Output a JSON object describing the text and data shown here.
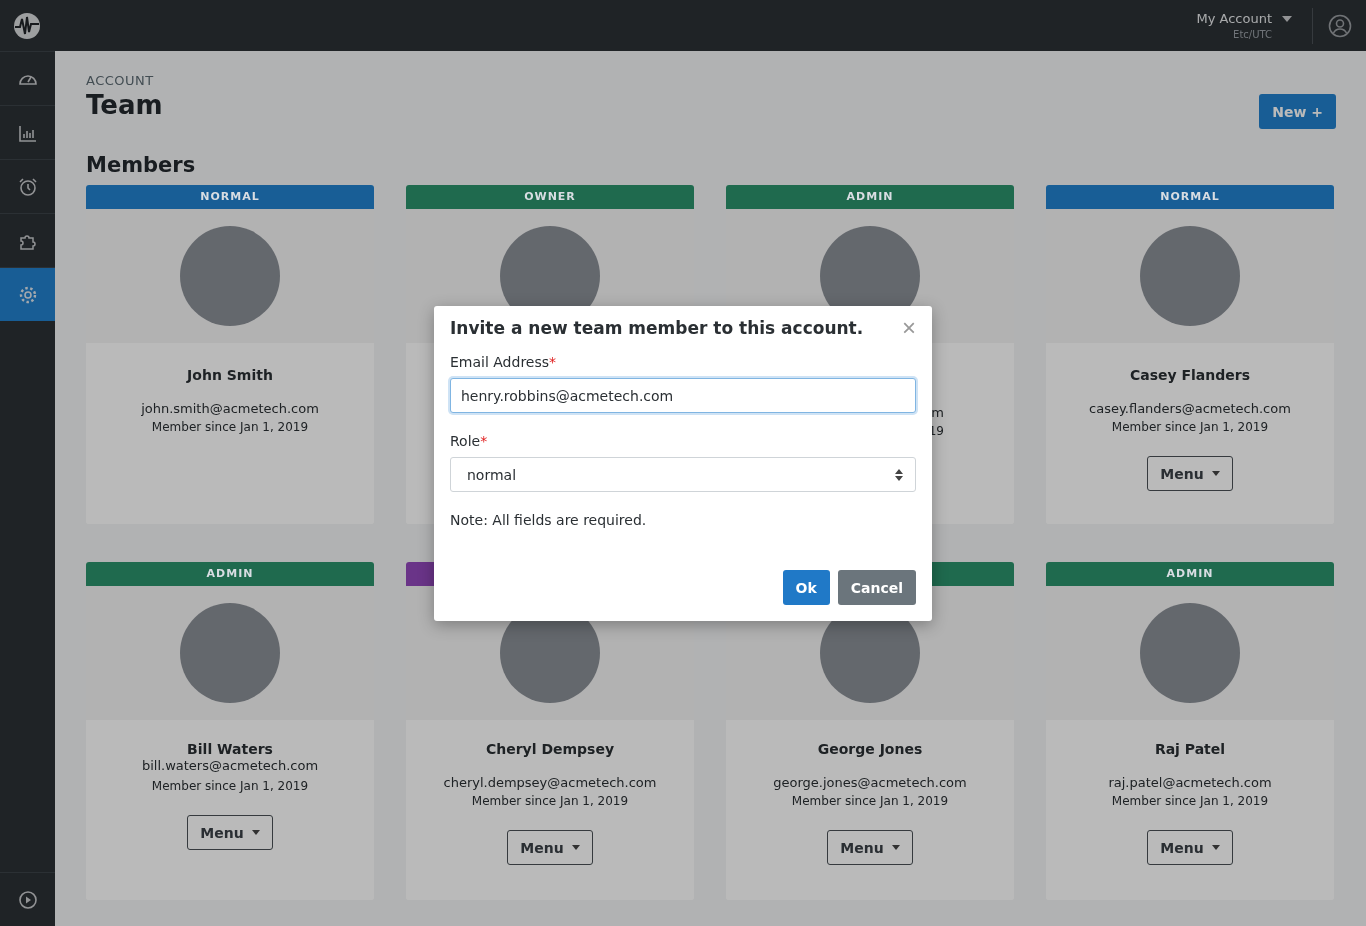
{
  "topbar": {
    "account": "My Account",
    "timezone": "Etc/UTC"
  },
  "sidebar": {
    "items": [
      {
        "kind": "gauge",
        "selected": false
      },
      {
        "kind": "chart",
        "selected": false
      },
      {
        "kind": "alarm",
        "selected": false
      },
      {
        "kind": "puzzle",
        "selected": false
      },
      {
        "kind": "gear",
        "selected": true
      }
    ],
    "bottom": {
      "kind": "play"
    }
  },
  "header": {
    "eyebrow": "ACCOUNT",
    "title": "Team",
    "new_button": "New +"
  },
  "section_title": "Members",
  "members": [
    {
      "role": "NORMAL",
      "color": "#185e96",
      "name": "John Smith",
      "email": "john.smith@acmetech.com",
      "since": "Member since Jan 1, 2019"
    },
    {
      "role": "OWNER",
      "color": "#1f6a4e"
    },
    {
      "role": "ADMIN",
      "color": "#1f6a4e",
      "email": "m",
      "since": "19",
      "partial": true
    },
    {
      "role": "NORMAL",
      "color": "#185e96",
      "name": "Casey Flanders",
      "email": "casey.flanders@acmetech.com",
      "since": "Member since Jan 1, 2019",
      "menu": "Menu"
    },
    {
      "role": "ADMIN",
      "color": "#1f6a4e",
      "name": "Bill Waters",
      "email": "bill.waters@acmetech.com",
      "since": "Member since Jan 1, 2019",
      "menu": "Menu"
    },
    {
      "color": "#6a3488",
      "name": "Cheryl Dempsey",
      "email": "cheryl.dempsey@acmetech.com",
      "since": "Member since Jan 1, 2019",
      "menu": "Menu"
    },
    {
      "color": "#1f6a4e",
      "name": "George Jones",
      "email": "george.jones@acmetech.com",
      "since": "Member since Jan 1, 2019",
      "menu": "Menu"
    },
    {
      "role": "ADMIN",
      "color": "#1f6a4e",
      "name": "Raj Patel",
      "email": "raj.patel@acmetech.com",
      "since": "Member since Jan 1, 2019",
      "menu": "Menu"
    }
  ],
  "modal": {
    "title": "Invite a new team member to this account.",
    "close": "×",
    "email_label": "Email Address",
    "required_mark": "*",
    "email_value": "henry.robbins@acmetech.com",
    "role_label": "Role",
    "role_value": "normal",
    "note": "Note: All fields are required.",
    "ok": "Ok",
    "cancel": "Cancel"
  }
}
